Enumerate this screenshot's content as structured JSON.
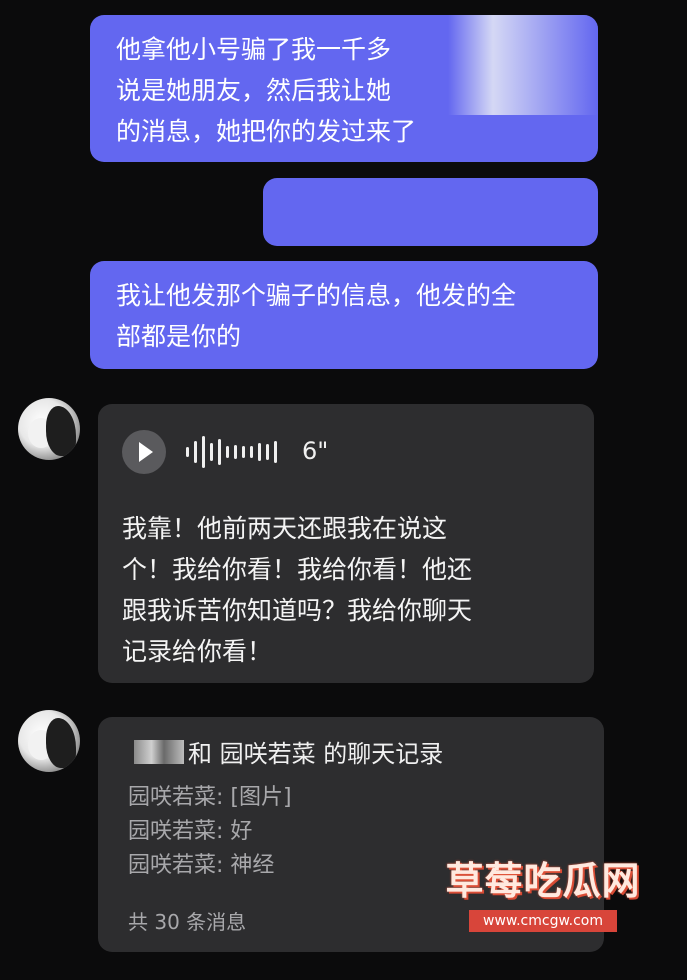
{
  "messages_out": [
    {
      "lines": [
        "他拿他小号骗了我一千多",
        "说是她朋友，然后我让她",
        "的消息，她把你的发过来了"
      ]
    },
    {
      "lines": []
    },
    {
      "lines": [
        "我让他发那个骗子的信息，他发的全",
        "部都是你的"
      ]
    }
  ],
  "voice_message": {
    "duration": "6\"",
    "transcript_lines": [
      "我靠！他前两天还跟我在说这",
      "个！我给你看！我给你看！他还",
      "跟我诉苦你知道吗？我给你聊天",
      "记录给你看！"
    ]
  },
  "chat_record": {
    "title_suffix": "和 园咲若菜 的聊天记录",
    "lines": [
      "园咲若菜: [图片]",
      "园咲若菜: 好",
      "园咲若菜: 神经"
    ],
    "count": "共 30 条消息"
  },
  "watermark": {
    "main": "草莓吃瓜网",
    "sub": "www.cmcgw.com"
  },
  "colors": {
    "background": "#0b0b0c",
    "outgoing_bubble": "#6367f0",
    "incoming_bubble": "#2d2d2f",
    "watermark_red": "#d8453a"
  }
}
